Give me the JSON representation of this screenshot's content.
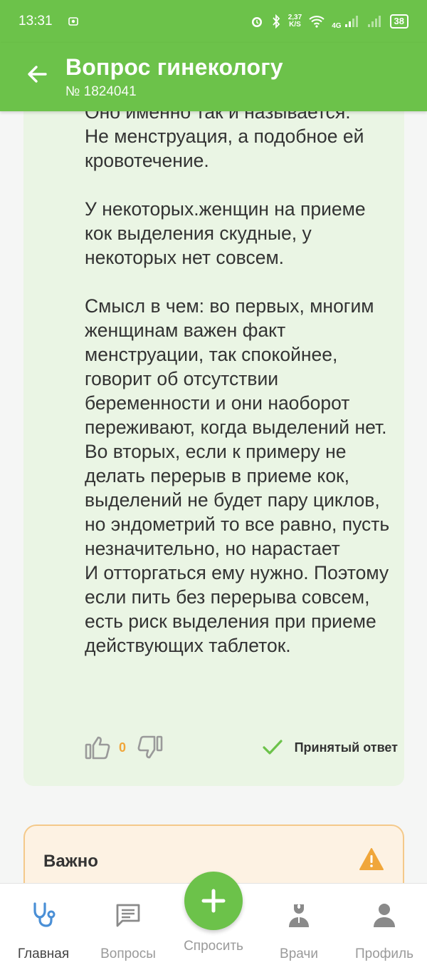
{
  "status_bar": {
    "time": "13:31",
    "net_speed": "2,37",
    "net_unit": "K/S",
    "network": "4G",
    "battery": "38"
  },
  "header": {
    "title": "Вопрос гинекологу",
    "question_number": "№ 1824041"
  },
  "answer": {
    "text": "Оно именно так и называется.\nНе менструация, а подобное ей кровотечение.\n\nУ некоторых.женщин на приеме кок выделения скудные, у некоторых нет совсем.\n\nСмысл в чем: во первых, многим женщинам важен факт менструации, так спокойнее, говорит об отсутствии беременности и они наоборот переживают, когда выделений нет.\nВо вторых, если к примеру не делать перерыв в приеме кок, выделений не будет пару циклов, но эндометрий то все равно, пусть незначительно, но нарастает\nИ отторгаться ему нужно. Поэтому если пить без перерыва совсем, есть риск выделения при приеме действующих таблеток.",
    "likes": "0",
    "accepted_label": "Принятый ответ"
  },
  "important": {
    "title": "Важно"
  },
  "nav": {
    "home": "Главная",
    "questions": "Вопросы",
    "ask": "Спросить",
    "doctors": "Врачи",
    "profile": "Профиль"
  },
  "colors": {
    "brand_green": "#6cc24a",
    "answer_bg": "#eaf5e4",
    "warning_orange": "#f0a63a"
  }
}
